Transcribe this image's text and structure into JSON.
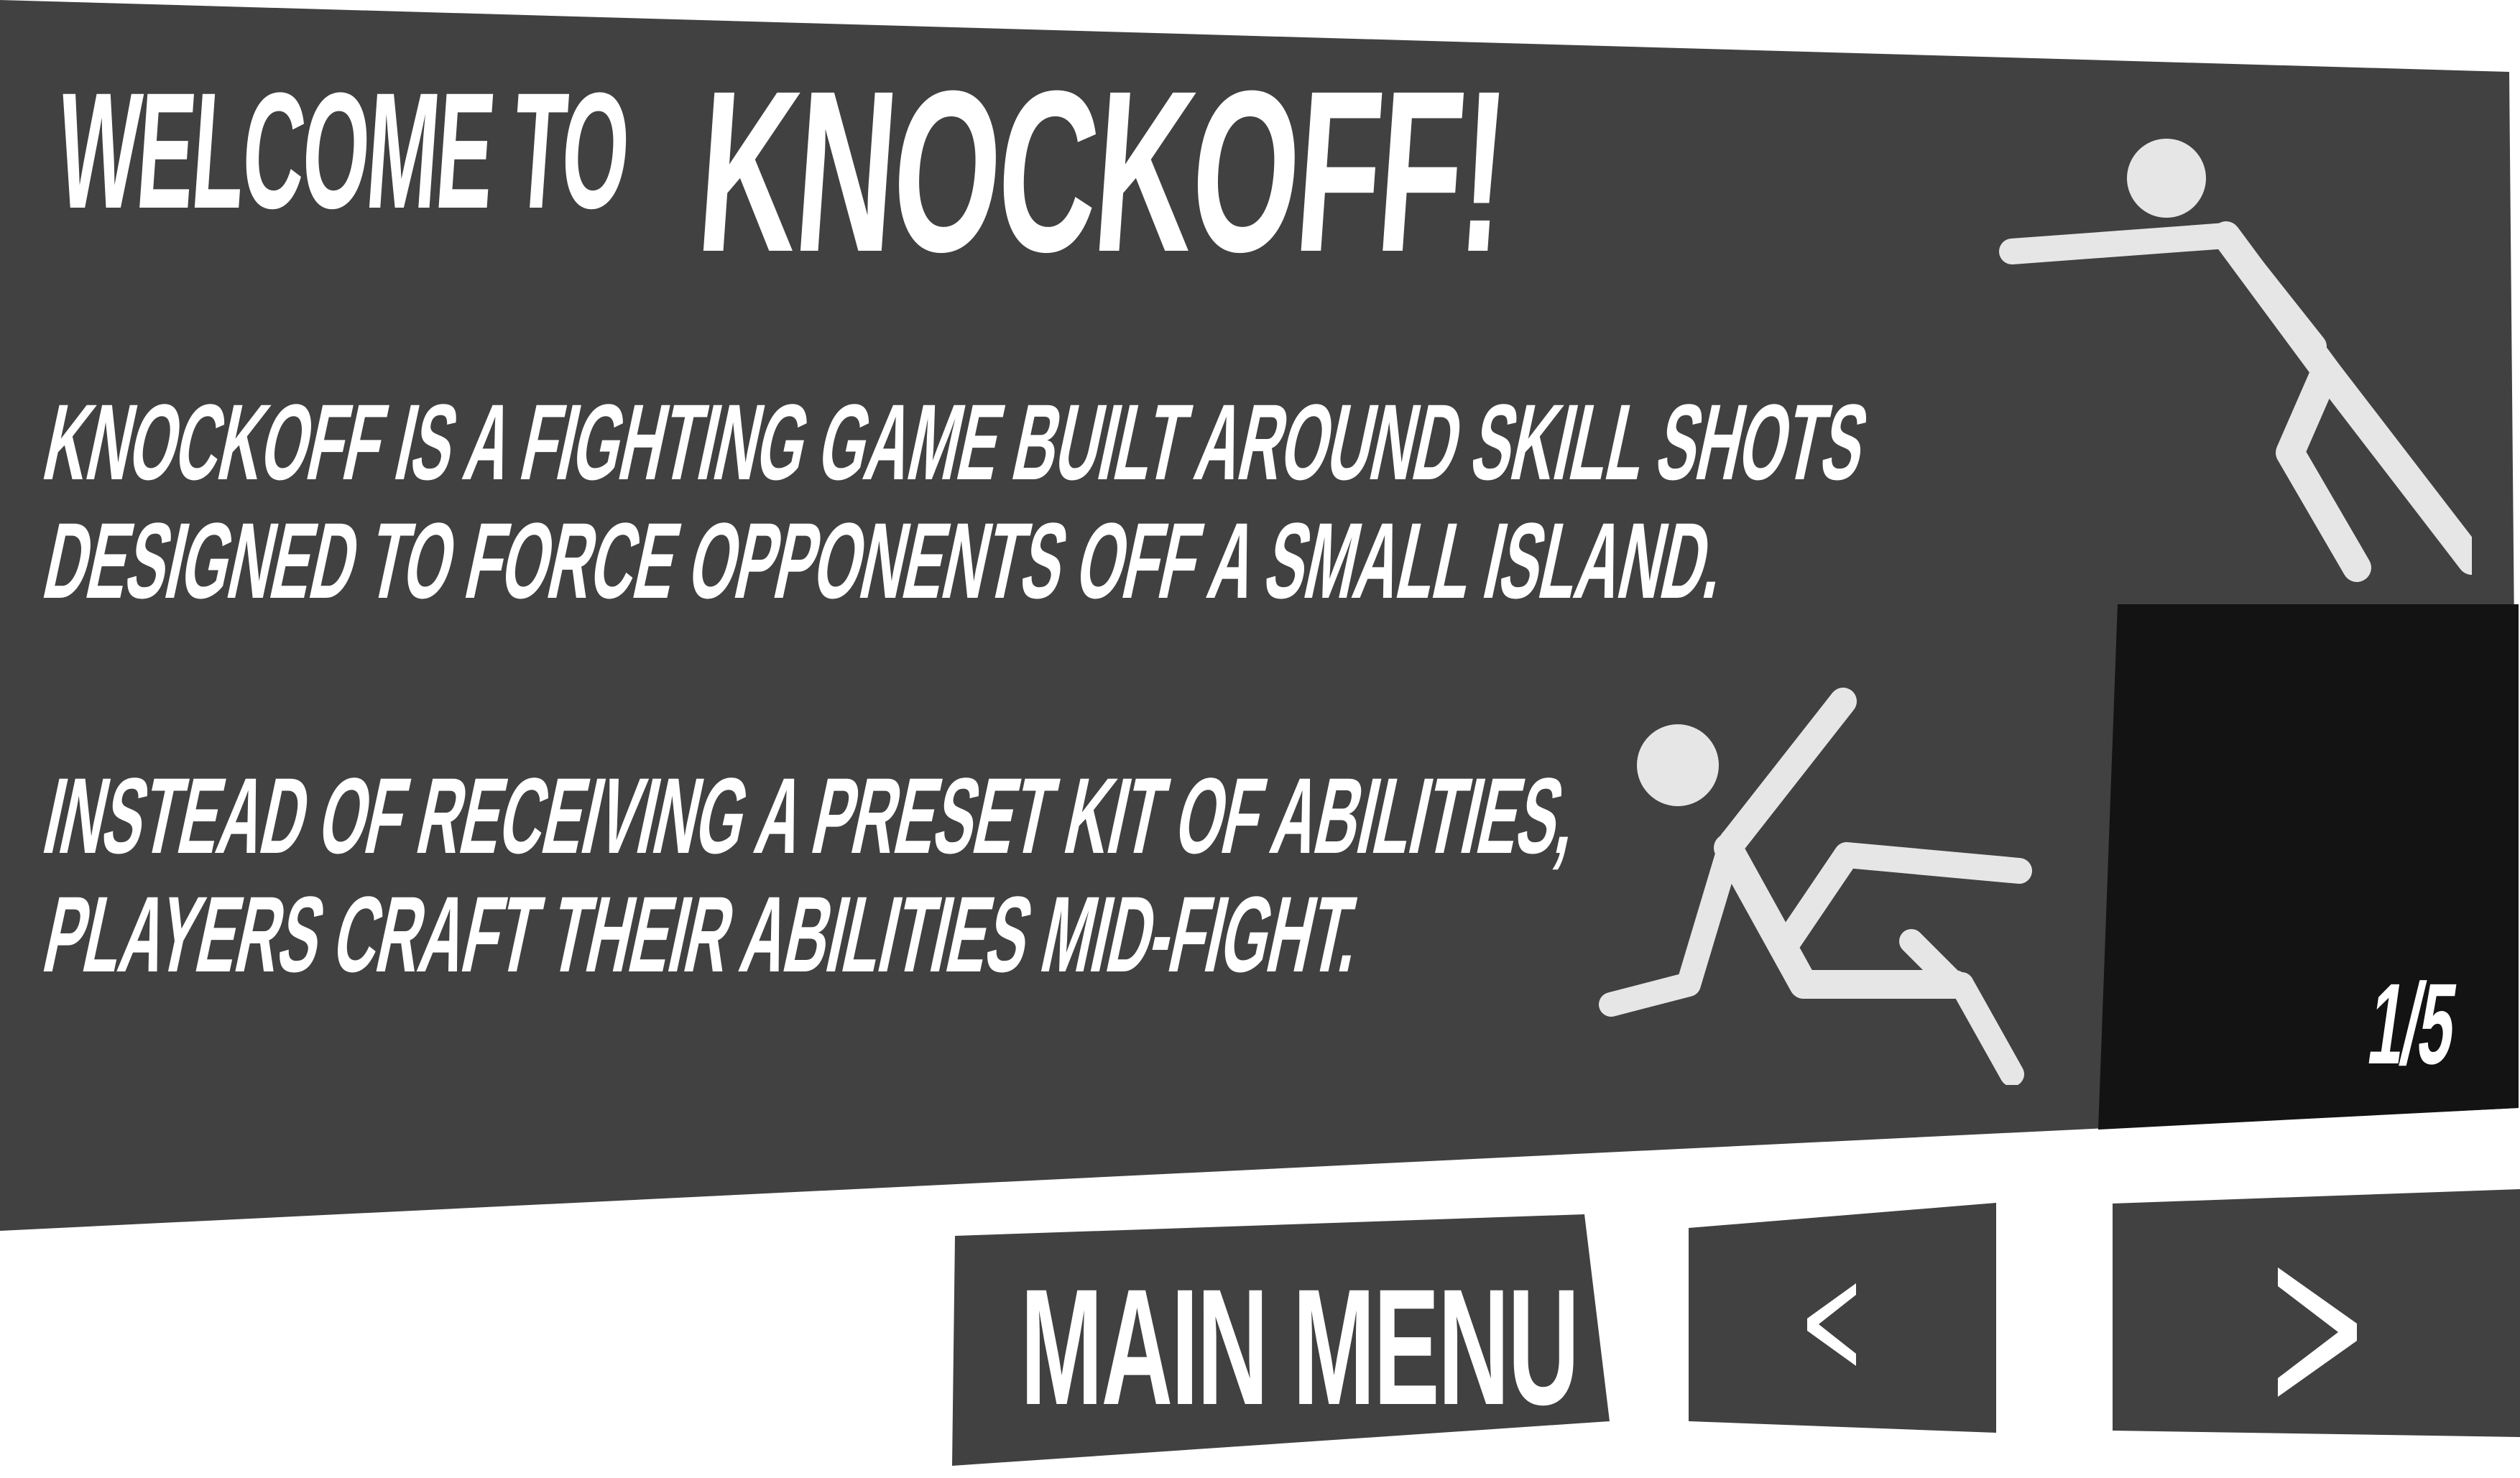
{
  "screen": {
    "title_prefix": "WELCOME TO",
    "title_game": "KNOCKOFF!",
    "body_lines": [
      "KNOCKOFF IS A FIGHTING GAME BUILT AROUND SKILL SHOTS",
      "DESIGNED TO FORCE OPPONENTS OFF A SMALL ISLAND.",
      "INSTEAD OF RECEIVING A PRESET KIT OF ABILITIES,",
      "PLAYERS CRAFT THEIR ABILITIES MID-FIGHT."
    ],
    "page_indicator": "1/5"
  },
  "buttons": {
    "main_menu_label": "MAIN MENU",
    "prev_icon": "chevron-left-icon",
    "next_icon": "chevron-right-icon"
  },
  "colors": {
    "panel": "#414141",
    "island": "#131313",
    "figure": "#e6e6e6",
    "text": "#ffffff",
    "background": "#ffffff"
  }
}
